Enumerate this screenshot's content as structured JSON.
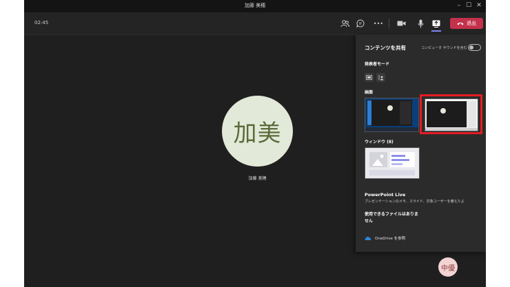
{
  "window": {
    "title": "加藤 美穂",
    "controls": {
      "minimize": "–",
      "maximize": "☐",
      "close": "✕"
    }
  },
  "toolbar": {
    "timer": "02:45",
    "icons": [
      "participants-icon",
      "chat-icon",
      "more-icon",
      "camera-icon",
      "mic-icon",
      "share-icon"
    ],
    "more_label": "•••",
    "leave_label": "退出",
    "leave_color": "#c4314b"
  },
  "stage": {
    "main_avatar": {
      "initials": "加美",
      "name": "加藤 美穂",
      "bg": "#e3e9d8"
    },
    "self_avatar": {
      "initials": "中優",
      "bg": "#f3d3d3"
    }
  },
  "share_panel": {
    "title": "コンテンツを共有",
    "audio_toggle_label": "コンピュータ サウンドを含む",
    "presenter_mode_heading": "発表者モード",
    "screen_heading": "画面",
    "window_heading": "ウィンドウ (8)",
    "powerpoint_title": "PowerPoint Live",
    "powerpoint_desc": "プレゼンテーションのメモ、スライド、対象ユーザーを備えたよ",
    "no_files": "使用できるファイルはありません",
    "onedrive_link": "OneDrive を参照",
    "selection_color": "#e51c23",
    "accent_color": "#7f85f5"
  }
}
